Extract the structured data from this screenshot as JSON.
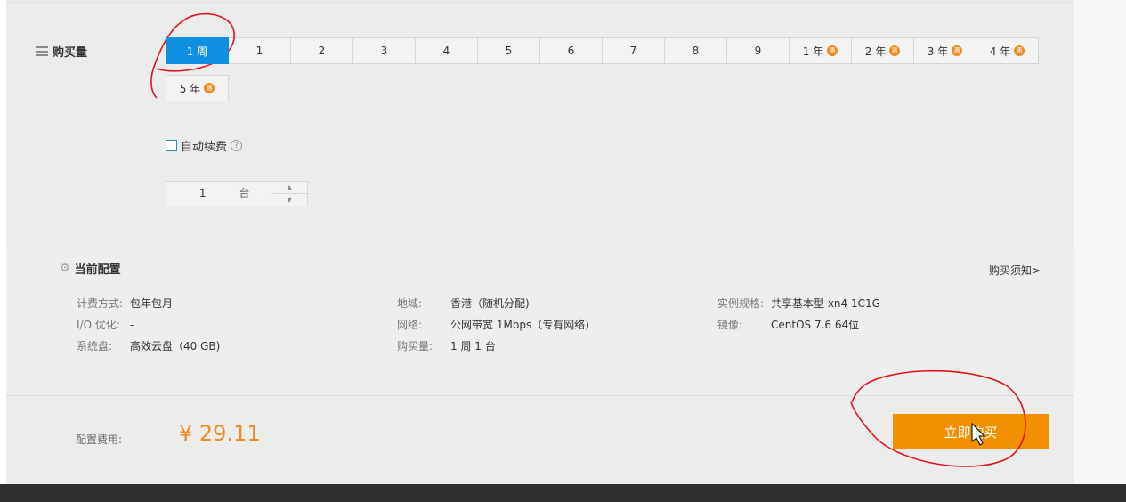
{
  "quantity": {
    "label": "购买量",
    "durations_row1": [
      "1 周",
      "1",
      "2",
      "3",
      "4",
      "5",
      "6",
      "7",
      "8",
      "9",
      "1 年",
      "2 年",
      "3 年",
      "4 年"
    ],
    "durations_row2": [
      "5 年"
    ],
    "selected": "1 周",
    "discount_badge": "惠"
  },
  "autorenew": {
    "label": "自动续费",
    "help": "?"
  },
  "stepper": {
    "value": "1",
    "unit": "台"
  },
  "config": {
    "title": "当前配置",
    "notice_link": "购买须知>",
    "items": [
      {
        "k": "计费方式:",
        "v": "包年包月"
      },
      {
        "k": "I/O 优化:",
        "v": "-"
      },
      {
        "k": "系统盘:",
        "v": "高效云盘（40 GB)"
      },
      {
        "k": "地域:",
        "v": "香港（随机分配)"
      },
      {
        "k": "网络:",
        "v": "公网带宽 1Mbps（专有网络)"
      },
      {
        "k": "购买量:",
        "v": "1 周 1 台"
      },
      {
        "k": "实例规格:",
        "v": "共享基本型 xn4 1C1G"
      },
      {
        "k": "镜像:",
        "v": "CentOS 7.6 64位"
      }
    ]
  },
  "footer": {
    "fee_label": "配置费用:",
    "fee_value": "¥ 29.11",
    "buy_button": "立即购买"
  },
  "colors": {
    "accent_blue": "#0e8fe0",
    "orange": "#f39000",
    "price": "#f08a1e"
  }
}
